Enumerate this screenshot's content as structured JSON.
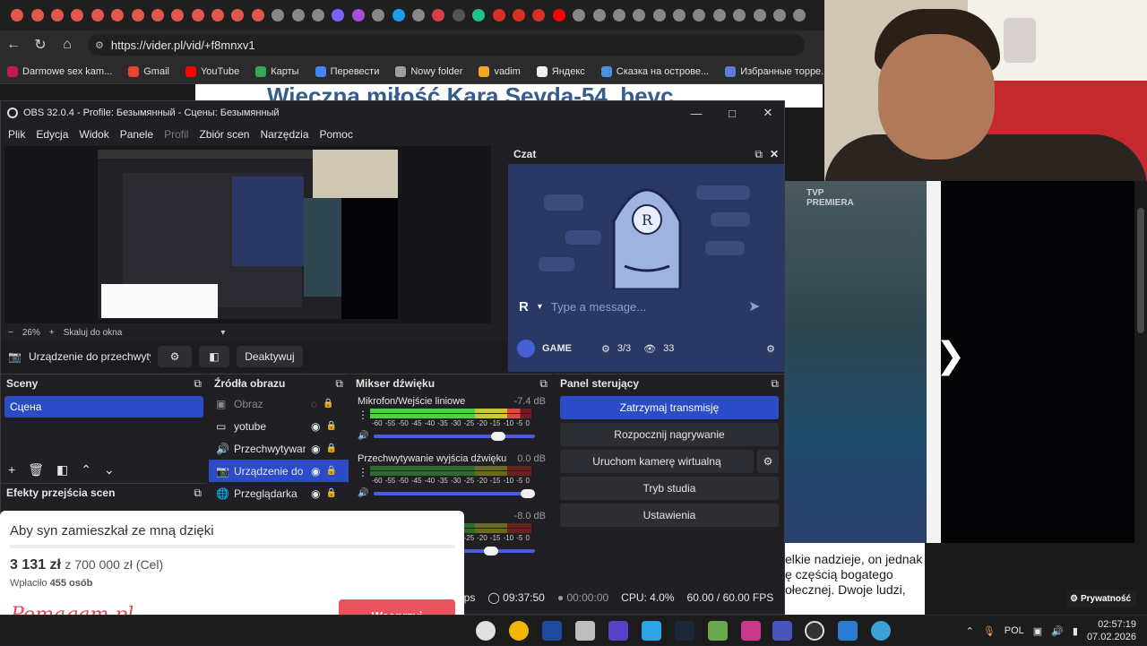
{
  "browser": {
    "url": "https://vider.pl/vid/+f8mnxv1",
    "bookmarks": [
      {
        "label": "Darmowe sex kam...",
        "color": "#c2185b"
      },
      {
        "label": "Gmail",
        "color": "#ea4335"
      },
      {
        "label": "YouTube",
        "color": "#ff0000"
      },
      {
        "label": "Карты",
        "color": "#34a853"
      },
      {
        "label": "Перевести",
        "color": "#4285f4"
      },
      {
        "label": "Nowy folder",
        "color": "#9e9e9e"
      },
      {
        "label": "vadim",
        "color": "#f5a623"
      },
      {
        "label": "Яндекс",
        "color": "#eeeeee"
      },
      {
        "label": "Сказка на острове...",
        "color": "#4a90e2"
      },
      {
        "label": "Избранные торре...",
        "color": "#5b7fd6"
      }
    ],
    "page_title": "Wieczna miłość Kara Sevda-54. bevc"
  },
  "obs": {
    "title": "OBS 32.0.4 - Profile: Безымянный - Сцены: Безымянный",
    "menu": [
      {
        "label": "Plik",
        "disabled": false
      },
      {
        "label": "Edycja",
        "disabled": false
      },
      {
        "label": "Widok",
        "disabled": false
      },
      {
        "label": "Panele",
        "disabled": false
      },
      {
        "label": "Profil",
        "disabled": true
      },
      {
        "label": "Zbiór scen",
        "disabled": false
      },
      {
        "label": "Narzędzia",
        "disabled": false
      },
      {
        "label": "Pomoc",
        "disabled": false
      }
    ],
    "zoom": "26%",
    "scale_mode": "Skaluj do okna",
    "source_name": "Urządzenie do przechwyty",
    "deactivate_label": "Deaktywuj",
    "chat": {
      "title": "Czat",
      "placeholder": "Type a message...",
      "channel": "GAME",
      "viewers_ratio": "3/3",
      "views": "33"
    },
    "scenes": {
      "title": "Sceny",
      "items": [
        "Сцена"
      ]
    },
    "transitions": {
      "title": "Efekty przejścia scen"
    },
    "sources": {
      "title": "Źródła obrazu",
      "items": [
        {
          "label": "Obraz",
          "icon": "image-icon",
          "hidden": true
        },
        {
          "label": "yotube",
          "icon": "monitor-icon",
          "hidden": false
        },
        {
          "label": "Przechwytywan",
          "icon": "speaker-icon",
          "hidden": false
        },
        {
          "label": "Urządzenie do p",
          "icon": "camera-icon",
          "hidden": false,
          "selected": true
        },
        {
          "label": "Przeglądarka",
          "icon": "globe-icon",
          "hidden": false
        }
      ]
    },
    "mixer": {
      "title": "Mikser dźwięku",
      "scale": [
        "-60",
        "-55",
        "-50",
        "-45",
        "-40",
        "-35",
        "-30",
        "-25",
        "-20",
        "-15",
        "-10",
        "-5",
        "0"
      ],
      "channels": [
        {
          "name": "Mikrofon/Wejście liniowe",
          "db": "-7.4 dB",
          "level": 0.93,
          "volume": 0.8
        },
        {
          "name": "Przechwytywanie wyjścia dźwięku",
          "db": "0.0 dB",
          "level": 0.0,
          "volume": 1.0
        },
        {
          "name": "",
          "db": "-8.0 dB",
          "level": 0.0,
          "volume": 0.75
        }
      ]
    },
    "controls": {
      "title": "Panel sterujący",
      "buttons": [
        "Zatrzymaj transmisję",
        "Rozpocznij nagrywanie",
        "Uruchom kamerę wirtualną",
        "Tryb studia",
        "Ustawienia"
      ]
    },
    "status": {
      "bitrate": "bps",
      "stream_time": "09:37:50",
      "rec_time": "00:00:00",
      "cpu": "CPU: 4.0%",
      "fps": "60.00 / 60.00 FPS"
    }
  },
  "donation": {
    "title": "Aby syn zamieszkał ze mną dzięki",
    "amount": "3 131 zł",
    "goal": "z 700 000 zł (Cel)",
    "count_prefix": "Wpłaciło",
    "count": "455 osób",
    "logo": "Pomagam.pl",
    "button": "Wesprzyj"
  },
  "video": {
    "channel_logo": "TVP",
    "channel_sub": "PREMIERA",
    "article_lines": [
      "elkie nadzieje, on jednak",
      "ę częścią bogatego",
      "ołecznej. Dwoje ludzi,",
      "",
      ""
    ],
    "privacy": "Prywatność"
  },
  "taskbar": {
    "lang": "POL",
    "time": "02:57:19",
    "date": "07.02.2026"
  },
  "colors": {
    "accent": "#2b4bc9",
    "chat_bg": "#2a3866",
    "donate": "#e8535d"
  }
}
